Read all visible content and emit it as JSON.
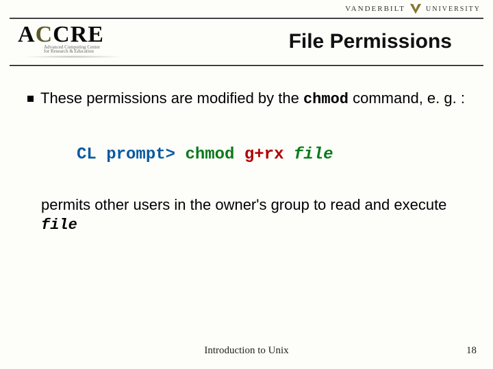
{
  "brand": {
    "vanderbilt_left": "VANDERBILT",
    "vanderbilt_right": "UNIVERSITY",
    "accre_letters": "ACCRE",
    "accre_sub1": "Advanced Computing Center",
    "accre_sub2": "for Research & Education"
  },
  "title": "File Permissions",
  "bullet1": {
    "text_before": "These permissions are modified by the ",
    "code": "chmod",
    "text_after": " command, e. g. :"
  },
  "command": {
    "prompt": "CL prompt>",
    "cmd": "chmod",
    "arg": "g+rx",
    "file": "file"
  },
  "para2": {
    "text_before": "permits other users in the owner's group to read and execute ",
    "file": "file"
  },
  "footer": {
    "title": "Introduction to Unix",
    "page": "18"
  }
}
